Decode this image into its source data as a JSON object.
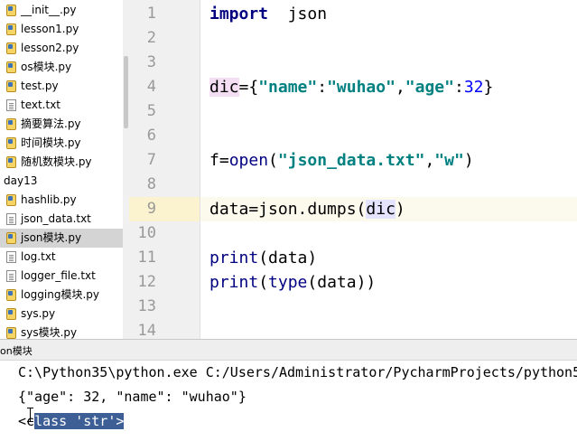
{
  "project_tree": {
    "items": [
      {
        "label": "__init__.py",
        "kind": "py"
      },
      {
        "label": "lesson1.py",
        "kind": "py"
      },
      {
        "label": "lesson2.py",
        "kind": "py"
      },
      {
        "label": "os模块.py",
        "kind": "py"
      },
      {
        "label": "test.py",
        "kind": "py"
      },
      {
        "label": "text.txt",
        "kind": "txt"
      },
      {
        "label": "摘要算法.py",
        "kind": "py"
      },
      {
        "label": "时间模块.py",
        "kind": "py"
      },
      {
        "label": "随机数模块.py",
        "kind": "py"
      },
      {
        "label": "day13",
        "kind": "folder"
      },
      {
        "label": "hashlib.py",
        "kind": "py"
      },
      {
        "label": "json_data.txt",
        "kind": "txt"
      },
      {
        "label": "json模块.py",
        "kind": "py",
        "selected": true
      },
      {
        "label": "log.txt",
        "kind": "txt"
      },
      {
        "label": "logger_file.txt",
        "kind": "txt"
      },
      {
        "label": "logging模块.py",
        "kind": "py"
      },
      {
        "label": "sys.py",
        "kind": "py"
      },
      {
        "label": "sys模块.py",
        "kind": "py"
      }
    ]
  },
  "editor": {
    "line_numbers": [
      "1",
      "2",
      "3",
      "4",
      "5",
      "6",
      "7",
      "8",
      "9",
      "10",
      "11",
      "12",
      "13",
      "14"
    ],
    "caret_line": 9,
    "lines": {
      "l1": {
        "kw": "import",
        "rest": "  json"
      },
      "l4": {
        "var": "dic",
        "eq": "={",
        "k1": "\"name\"",
        "c1": ":",
        "v1": "\"wuhao\"",
        "sep": ",",
        "k2": "\"age\"",
        "c2": ":",
        "v2": "32",
        "end": "}"
      },
      "l7": {
        "pre": "f=",
        "fn": "open",
        "p1": "(",
        "s1": "\"json_data.txt\"",
        "sep": ",",
        "s2": "\"w\"",
        "p2": ")"
      },
      "l9": {
        "pre": "data=json.dumps(",
        "arg": "dic",
        "post": ")"
      },
      "l11": {
        "fn": "print",
        "rest": "(data)"
      },
      "l12": {
        "fn": "print",
        "p1": "(",
        "fn2": "type",
        "rest": "(data))"
      }
    }
  },
  "run_panel": {
    "title": "on模块",
    "output": {
      "command": "C:\\Python35\\python.exe C:/Users/Administrator/PycharmProjects/python5",
      "json_line": "{\"age\": 32, \"name\": \"wuhao\"}",
      "type_prefix": "<c",
      "type_selected": "lass 'str'>"
    }
  },
  "colors": {
    "keyword": "#000080",
    "string": "#008080",
    "number": "#0000ff",
    "caret_line": "#fcfaed",
    "selection": "#3d5f96",
    "gutter": "#f0f0f0"
  }
}
